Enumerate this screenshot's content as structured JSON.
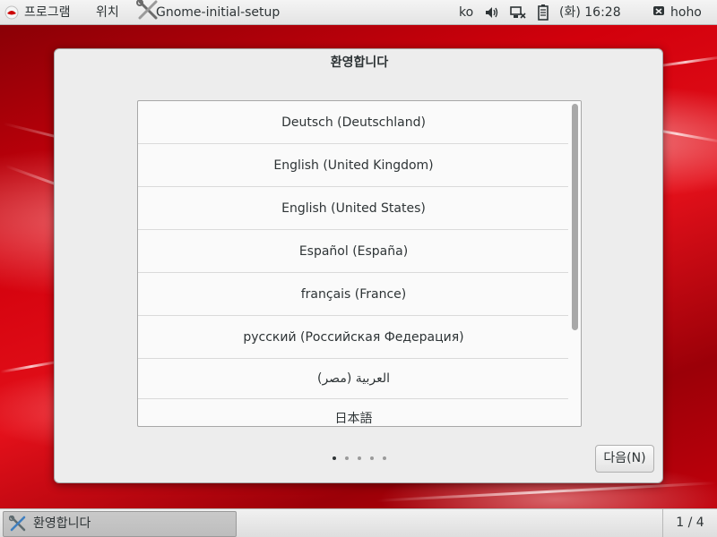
{
  "topbar": {
    "applications_label": "프로그램",
    "places_label": "위치",
    "active_app_label": "Gnome-initial-setup",
    "keyboard_layout": "ko",
    "clock": "(화) 16:28",
    "user_name": "hoho"
  },
  "dialog": {
    "title": "환영합니다",
    "languages": [
      "Deutsch (Deutschland)",
      "English (United Kingdom)",
      "English (United States)",
      "Español (España)",
      "français (France)",
      "русский (Российская Федерация)",
      "العربية (مصر)",
      "日本語"
    ],
    "page_count": 5,
    "current_page": 1,
    "next_button_label": "다음(N)"
  },
  "taskbar": {
    "task_label": "환영합니다",
    "workspace_indicator": "1 / 4"
  }
}
